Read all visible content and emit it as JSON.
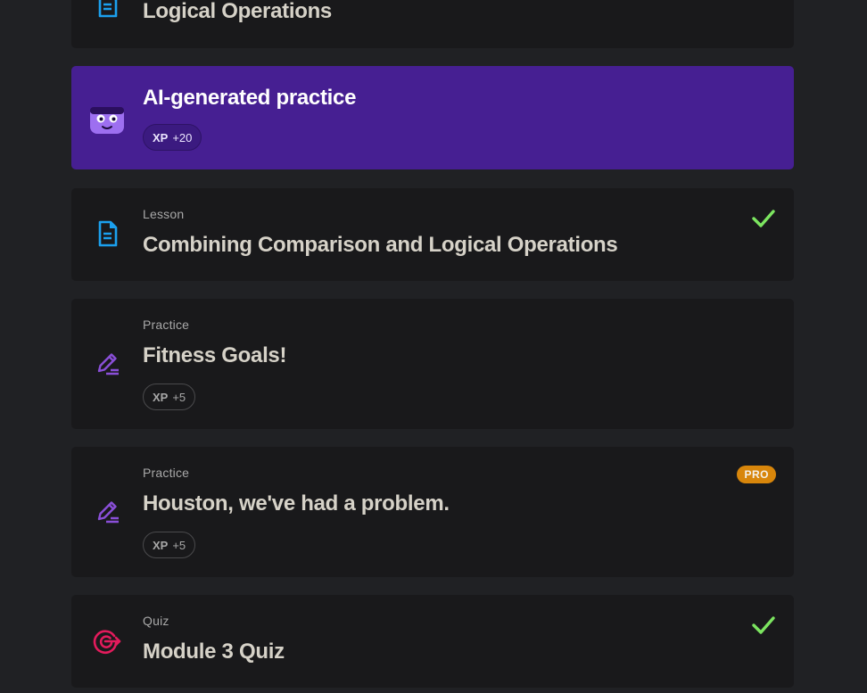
{
  "colors": {
    "page_bg": "#202124",
    "card_bg": "#19191b",
    "ai_card_bg": "#461f92",
    "lesson_icon": "#1ba0ee",
    "practice_icon": "#8a4fd8",
    "quiz_icon": "#e31b5c",
    "check": "#7ce560",
    "pro_badge": "#d8860b"
  },
  "cards": [
    {
      "title": "Logical Operations",
      "icon": "document-icon"
    },
    {
      "title": "AI-generated practice",
      "icon": "ai-mascot-icon",
      "xp_label": "XP",
      "xp_value": "+20"
    },
    {
      "type": "Lesson",
      "title": "Combining Comparison and Logical Operations",
      "icon": "document-icon",
      "completed": true
    },
    {
      "type": "Practice",
      "title": "Fitness Goals!",
      "icon": "pencil-icon",
      "xp_label": "XP",
      "xp_value": "+5"
    },
    {
      "type": "Practice",
      "title": "Houston, we've had a problem.",
      "icon": "pencil-icon",
      "xp_label": "XP",
      "xp_value": "+5",
      "badge": "PRO"
    },
    {
      "type": "Quiz",
      "title": "Module 3 Quiz",
      "icon": "target-icon",
      "completed": true
    }
  ]
}
